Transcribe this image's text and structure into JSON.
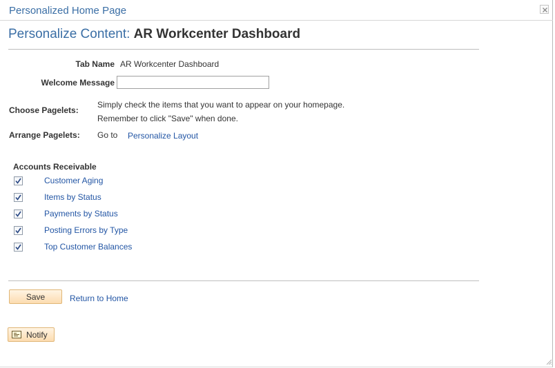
{
  "window": {
    "title": "Personalized Home Page",
    "close_symbol": "close-icon"
  },
  "page": {
    "title_prefix": "Personalize Content:",
    "title_subject": "AR Workcenter Dashboard"
  },
  "form": {
    "tab_name_label": "Tab Name",
    "tab_name_value": "AR Workcenter Dashboard",
    "welcome_label": "Welcome Message",
    "welcome_value": "",
    "choose_label": "Choose Pagelets:",
    "choose_line1": "Simply check the items that you want to appear on your homepage.",
    "choose_line2": "Remember to click \"Save\" when done.",
    "arrange_label": "Arrange Pagelets:",
    "arrange_goto": "Go to",
    "arrange_link": "Personalize Layout"
  },
  "pagelets": {
    "group_title": "Accounts Receivable",
    "items": [
      {
        "label": "Customer Aging",
        "checked": true
      },
      {
        "label": "Items by Status",
        "checked": true
      },
      {
        "label": "Payments by Status",
        "checked": true
      },
      {
        "label": "Posting Errors by Type",
        "checked": true
      },
      {
        "label": "Top Customer Balances",
        "checked": true
      }
    ]
  },
  "actions": {
    "save_label": "Save",
    "return_label": "Return to Home",
    "notify_label": "Notify"
  },
  "colors": {
    "title_blue": "#3a6ea5",
    "link_blue": "#2255a4",
    "button_fill": "#fcdcb0",
    "button_border": "#e0b676",
    "checkmark": "#2c4a86"
  },
  "icons": {
    "close": "close-icon",
    "checkbox": "checkmark-icon",
    "notify": "notify-icon",
    "grip": "resize-grip-icon"
  }
}
